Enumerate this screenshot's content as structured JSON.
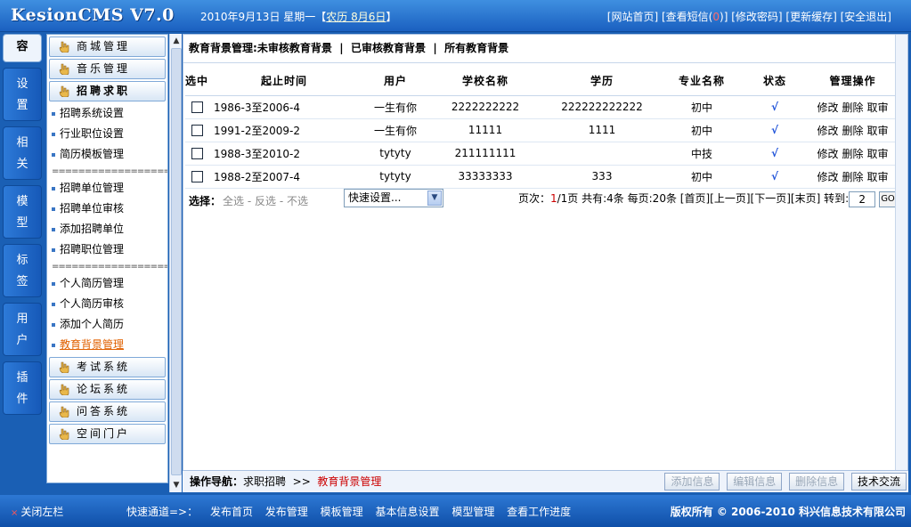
{
  "header": {
    "logo": "KesionCMS V7.0",
    "date": "2010年9月13日 星期一",
    "lunar_open": "【",
    "lunar": "农历 8月6日",
    "lunar_close": "】",
    "links": [
      "[网站首页]",
      "[查看短信(",
      "0",
      ")]",
      "[修改密码]",
      "[更新缓存]",
      "[安全退出]"
    ]
  },
  "tabs": [
    {
      "label": "容"
    },
    {
      "label": "设\n置"
    },
    {
      "label": "相\n关"
    },
    {
      "label": "模\n型"
    },
    {
      "label": "标\n签"
    },
    {
      "label": "用\n户"
    },
    {
      "label": "插\n件"
    }
  ],
  "sidebar": {
    "top_buttons": [
      "商城管理",
      "音乐管理",
      "招聘求职"
    ],
    "group1": [
      "招聘系统设置",
      "行业职位设置",
      "简历模板管理"
    ],
    "separator": "===================",
    "group2": [
      "招聘单位管理",
      "招聘单位审核",
      "添加招聘单位",
      "招聘职位管理"
    ],
    "group3": [
      "个人简历管理",
      "个人简历审核",
      "添加个人简历",
      "教育背景管理"
    ],
    "bottom_buttons": [
      "考试系统",
      "论坛系统",
      "问答系统",
      "空间门户"
    ]
  },
  "main": {
    "tabbar": {
      "prefix": "教育背景管理:",
      "items": [
        "未审核教育背景",
        "已审核教育背景",
        "所有教育背景"
      ],
      "divider": "|"
    },
    "columns": [
      "选中",
      "起止时间",
      "用户",
      "学校名称",
      "学历",
      "专业名称",
      "状态",
      "管理操作"
    ],
    "rows": [
      {
        "time": "1986-3至2006-4",
        "user": "一生有你",
        "school": "2222222222",
        "edu": "222222222222",
        "major": "初中",
        "status": "√"
      },
      {
        "time": "1991-2至2009-2",
        "user": "一生有你",
        "school": "11111",
        "edu": "1111",
        "major": "初中",
        "status": "√"
      },
      {
        "time": "1988-3至2010-2",
        "user": "tytyty",
        "school": "211111111",
        "edu": "",
        "major": "中技",
        "status": "√"
      },
      {
        "time": "1988-2至2007-4",
        "user": "tytyty",
        "school": "33333333",
        "edu": "333",
        "major": "初中",
        "status": "√"
      }
    ],
    "ops": [
      "修改",
      "删除",
      "取审"
    ],
    "select_label": "选择：",
    "select_links": [
      "全选",
      " - ",
      "反选",
      " - ",
      "不选"
    ],
    "quickset": "快速设置...",
    "pager": {
      "page_label": "页次：",
      "current": "1",
      "total": "/1页",
      "count": "共有:4条",
      "per_page": "每页:20条",
      "first": "[首页]",
      "prev": "[上一页]",
      "next": "[下一页]",
      "last": "[末页]",
      "goto_label": "转到:",
      "goto_value": "2",
      "go": "GO"
    }
  },
  "opnav": {
    "label": "操作导航：",
    "path1": "求职招聘",
    "arrow": ">>",
    "path2": "教育背景管理",
    "buttons": [
      "添加信息",
      "编辑信息",
      "删除信息",
      "技术交流"
    ]
  },
  "footer": {
    "close_left": "关闭左栏",
    "close_icon": "×",
    "quick_label": "快速通道=>：",
    "quick_links": [
      "发布首页",
      "发布管理",
      "模板管理",
      "基本信息设置",
      "模型管理",
      "查看工作进度"
    ],
    "copyright": "版权所有 © 2006-2010 科兴信息技术有限公司"
  },
  "colors": {
    "accent": "#1a5fb4",
    "active_link": "#e06000",
    "pager_current": "#cc0000"
  }
}
